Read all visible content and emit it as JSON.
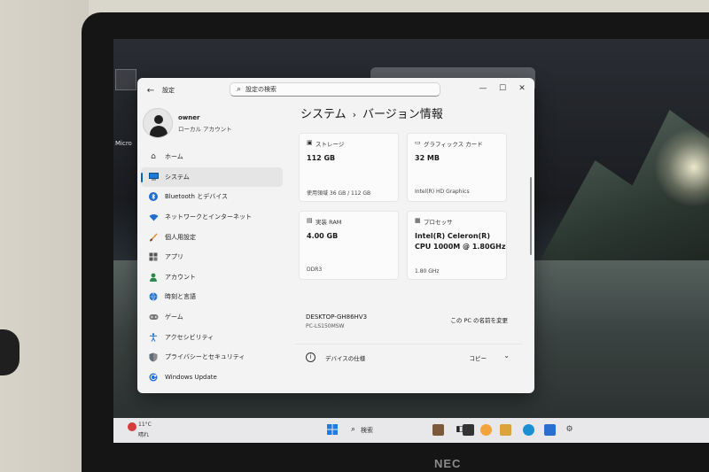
{
  "window": {
    "app_title": "設定",
    "search_placeholder": "設定の検索",
    "controls": [
      "—",
      "☐",
      "✕"
    ]
  },
  "profile": {
    "name": "owner",
    "account_type": "ローカル アカウント"
  },
  "sidebar": {
    "items": [
      {
        "label": "ホーム",
        "icon": "home-icon"
      },
      {
        "label": "システム",
        "icon": "system-icon",
        "active": true
      },
      {
        "label": "Bluetooth とデバイス",
        "icon": "bluetooth-icon"
      },
      {
        "label": "ネットワークとインターネット",
        "icon": "network-icon"
      },
      {
        "label": "個人用設定",
        "icon": "brush-icon"
      },
      {
        "label": "アプリ",
        "icon": "apps-icon"
      },
      {
        "label": "アカウント",
        "icon": "account-icon"
      },
      {
        "label": "時刻と言語",
        "icon": "globe-clock-icon"
      },
      {
        "label": "ゲーム",
        "icon": "gamepad-icon"
      },
      {
        "label": "アクセシビリティ",
        "icon": "accessibility-icon"
      },
      {
        "label": "プライバシーとセキュリティ",
        "icon": "shield-icon"
      },
      {
        "label": "Windows Update",
        "icon": "update-icon"
      }
    ]
  },
  "content": {
    "breadcrumb_parent": "システム",
    "breadcrumb_sep": "›",
    "breadcrumb_current": "バージョン情報",
    "cards": {
      "storage": {
        "label": "ストレージ",
        "value": "112 GB",
        "sub": "使用領域 36 GB / 112 GB"
      },
      "graphics": {
        "label": "グラフィックス カード",
        "value": "32 MB",
        "sub": "Intel(R) HD Graphics"
      },
      "ram": {
        "label": "実装 RAM",
        "value": "4.00 GB",
        "sub": "DDR3"
      },
      "processor": {
        "label": "プロセッサ",
        "value_line1": "Intel(R) Celeron(R)",
        "value_line2": "CPU 1000M @ 1.80GHz",
        "sub": "1.80 GHz"
      }
    },
    "device": {
      "name": "DESKTOP-GH86HV3",
      "model": "PC-LS150MSW",
      "rename_label": "この PC の名前を変更"
    },
    "specs": {
      "label": "デバイスの仕様",
      "copy_label": "コピー"
    }
  },
  "taskbar": {
    "weather_temp": "11°C",
    "weather_condition": "晴れ",
    "search_label": "検索"
  },
  "desktop": {
    "icon_label": "Micro"
  },
  "bezel": {
    "brand": "NEC"
  },
  "colors": {
    "accent": "#0067c0",
    "window_bg": "#f3f3f3",
    "card_bg": "#fbfbfb"
  }
}
